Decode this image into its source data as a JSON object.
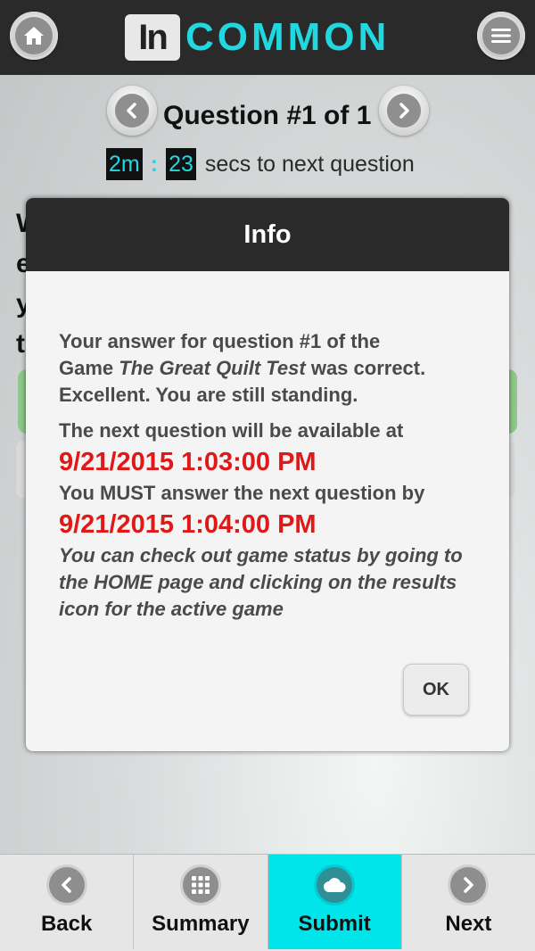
{
  "header": {
    "logo_in": "In",
    "logo_word": "COMMON",
    "home_icon": "home-icon",
    "menu_icon": "menu-icon"
  },
  "question_nav": {
    "title": "Question #1 of 1"
  },
  "timer": {
    "minutes": "2m",
    "separator": ":",
    "seconds": "23",
    "label": "secs to next question"
  },
  "modal": {
    "title": "Info",
    "line1": "Your answer for question #1 of the",
    "line2_prefix": "Game ",
    "game_name": "The Great Quilt Test",
    "line2_suffix": " was correct.",
    "line3": "Excellent. You are still standing.",
    "next_available_label": "The next question will be available at",
    "next_available_date": "9/21/2015 1:03:00 PM",
    "must_answer_label": "You MUST answer the next question by",
    "must_answer_date": "9/21/2015 1:04:00 PM",
    "note": "You can check out game status by going to the HOME page and clicking on the results icon for the active game",
    "ok_label": "OK"
  },
  "tabs": [
    {
      "label": "Back",
      "icon": "chevron-left-icon",
      "active": false
    },
    {
      "label": "Summary",
      "icon": "grid-icon",
      "active": false
    },
    {
      "label": "Submit",
      "icon": "cloud-icon",
      "active": true
    },
    {
      "label": "Next",
      "icon": "chevron-right-icon",
      "active": false
    }
  ],
  "colors": {
    "accent": "#00e5ea",
    "header_bg": "#2a2a2a",
    "alert_red": "#e01818"
  }
}
